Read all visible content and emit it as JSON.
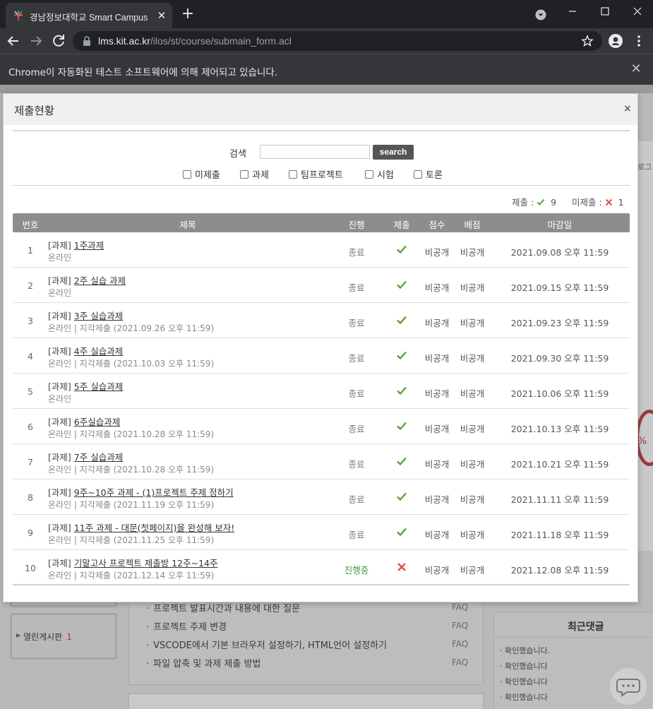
{
  "browser": {
    "tab_title": "경남정보대학교 Smart Campus",
    "url_host": "lms.kit.ac.kr",
    "url_path": "/ilos/st/course/submain_form.acl",
    "infobar_text": "Chrome이 자동화된 테스트 소프트웨어에 의해 제어되고 있습니다."
  },
  "background": {
    "login_fragment": "로그",
    "percent_fragment": "%",
    "board_label": "열린게시판",
    "board_count": "1",
    "faq_items": [
      {
        "text": "프로젝트 발표시간과 내용에 대한 질문",
        "tag": "FAQ"
      },
      {
        "text": "프로젝트 주제 변경",
        "tag": "FAQ"
      },
      {
        "text": "VSCODE에서 기본 브라우저 설정하기, HTML언어 설정하기",
        "tag": "FAQ"
      },
      {
        "text": "파일 압축 및 과제 제출 방법",
        "tag": "FAQ"
      }
    ],
    "recent_comments_title": "최근댓글",
    "recent_comments": [
      "확인했습니다.",
      "확인했습니다",
      "확인했습니다",
      "확인했습니다"
    ]
  },
  "modal": {
    "title": "제출현황",
    "close": "×",
    "search_label": "검색",
    "search_value": "",
    "search_button": "search",
    "filters": [
      "미제출",
      "과제",
      "팀프로젝트",
      "시험",
      "토론"
    ],
    "summary": {
      "submitted_label": "제출 :",
      "submitted_count": "9",
      "unsubmitted_label": "미제출 :",
      "unsubmitted_count": "1"
    },
    "columns": [
      "번호",
      "제목",
      "진행",
      "제출",
      "점수",
      "배점",
      "마감일"
    ],
    "rows": [
      {
        "no": "1",
        "type": "[과제]",
        "title": "1주과제",
        "sub": "온라인",
        "status": "종료",
        "submitted": true,
        "score": "비공개",
        "points": "비공개",
        "deadline": "2021.09.08 오후 11:59"
      },
      {
        "no": "2",
        "type": "[과제]",
        "title": "2주 실습 과제",
        "sub": "온라인",
        "status": "종료",
        "submitted": true,
        "score": "비공개",
        "points": "비공개",
        "deadline": "2021.09.15 오후 11:59"
      },
      {
        "no": "3",
        "type": "[과제]",
        "title": "3주 실습과제",
        "sub": "온라인 | 지각제출 (2021.09.26 오후 11:59)",
        "status": "종료",
        "submitted": true,
        "score": "비공개",
        "points": "비공개",
        "deadline": "2021.09.23 오후 11:59"
      },
      {
        "no": "4",
        "type": "[과제]",
        "title": "4주 실습과제",
        "sub": "온라인 | 지각제출 (2021.10.03 오후 11:59)",
        "status": "종료",
        "submitted": true,
        "score": "비공개",
        "points": "비공개",
        "deadline": "2021.09.30 오후 11:59"
      },
      {
        "no": "5",
        "type": "[과제]",
        "title": "5주 실습과제",
        "sub": "온라인",
        "status": "종료",
        "submitted": true,
        "score": "비공개",
        "points": "비공개",
        "deadline": "2021.10.06 오후 11:59"
      },
      {
        "no": "6",
        "type": "[과제]",
        "title": "6주실습과제",
        "sub": "온라인 | 지각제출 (2021.10.28 오후 11:59)",
        "status": "종료",
        "submitted": true,
        "score": "비공개",
        "points": "비공개",
        "deadline": "2021.10.13 오후 11:59"
      },
      {
        "no": "7",
        "type": "[과제]",
        "title": "7주 실습과제",
        "sub": "온라인 | 지각제출 (2021.10.28 오후 11:59)",
        "status": "종료",
        "submitted": true,
        "score": "비공개",
        "points": "비공개",
        "deadline": "2021.10.21 오후 11:59"
      },
      {
        "no": "8",
        "type": "[과제]",
        "title": "9주~10주 과제 - (1)프로젝트 주제 정하기",
        "sub": "온라인 | 지각제출 (2021.11.19 오후 11:59)",
        "status": "종료",
        "submitted": true,
        "score": "비공개",
        "points": "비공개",
        "deadline": "2021.11.11 오후 11:59"
      },
      {
        "no": "9",
        "type": "[과제]",
        "title": "11주 과제 - 대문(첫페이지)을 완성해 보자!",
        "sub": "온라인 | 지각제출 (2021.11.25 오후 11:59)",
        "status": "종료",
        "submitted": true,
        "score": "비공개",
        "points": "비공개",
        "deadline": "2021.11.18 오후 11:59"
      },
      {
        "no": "10",
        "type": "[과제]",
        "title": "기말고사 프로젝트 제출방 12주~14주",
        "sub": "온라인 | 지각제출 (2021.12.14 오후 11:59)",
        "status": "진행중",
        "submitted": false,
        "score": "비공개",
        "points": "비공개",
        "deadline": "2021.12.08 오후 11:59"
      }
    ]
  },
  "colors": {
    "check": "#5aa332",
    "cross": "#e0553f",
    "ongoing": "#3b9a3b",
    "header": "#8d8d8d"
  }
}
